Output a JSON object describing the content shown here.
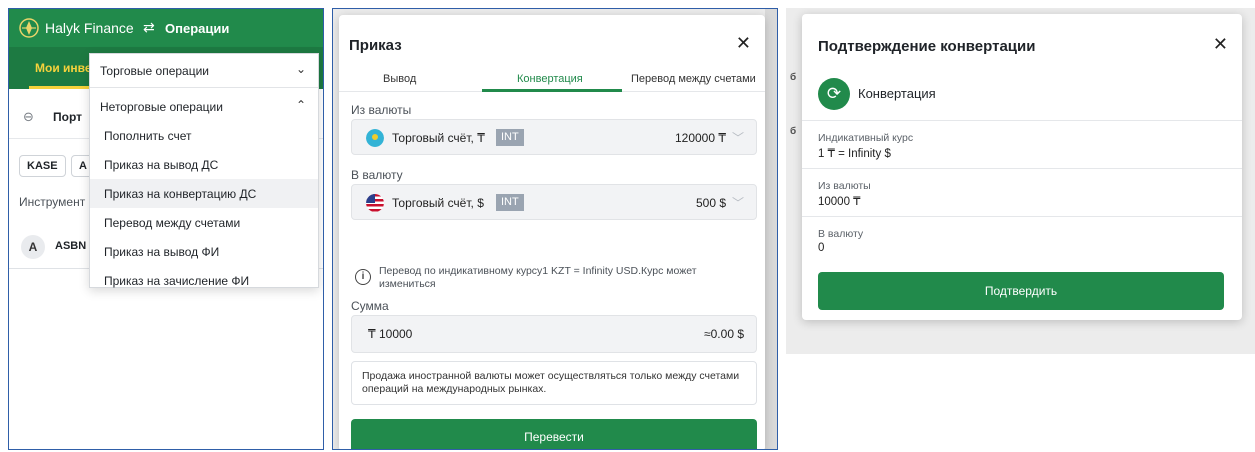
{
  "panel1": {
    "brand": "Halyk Finance",
    "nav_operations": "Операции",
    "tab_my_investments": "Мои инве",
    "portfolio_label": "Порт",
    "chip_kase": "KASE",
    "chip_a": "A",
    "instruments_label": "Инструмент",
    "row_avatar_letter": "A",
    "row_ticker": "ASBN",
    "dropdown": {
      "trade_ops": "Торговые операции",
      "nontrade_ops": "Неторговые операции",
      "items": [
        "Пополнить счет",
        "Приказ на вывод ДС",
        "Приказ на конвертацию ДС",
        "Перевод между счетами",
        "Приказ на вывод ФИ",
        "Приказ на зачисление ФИ"
      ]
    }
  },
  "panel2": {
    "title": "Приказ",
    "close": "✕",
    "tabs": [
      "Вывод",
      "Конвертация",
      "Перевод между счетами"
    ],
    "from_label": "Из валюты",
    "from_account": "Торговый счёт, ₸",
    "from_badge": "INT",
    "from_amount": "120000 ₸",
    "to_label": "В валюту",
    "to_account": "Торговый счёт, $",
    "to_badge": "INT",
    "to_amount": "500 $",
    "info_text": "Перевод по индикативному курсу1 KZT = Infinity USD.Курс может измениться",
    "sum_label": "Сумма",
    "sum_value": "₸  10000",
    "sum_converted": "≈0.00 $",
    "note": "Продажа иностранной валюты может осуществляться только между счетами операций на международных рынках.",
    "button": "Перевести"
  },
  "panel3": {
    "title": "Подтверждение конвертации",
    "close": "✕",
    "type_label": "Конвертация",
    "rate_label": "Индикативный курс",
    "rate_value": "1 ₸ = Infinity $",
    "from_label": "Из валюты",
    "from_value": "10000 ₸",
    "to_label": "В валюту",
    "to_value": "0",
    "button": "Подтвердить"
  },
  "colors": {
    "brand_green": "#218a4b",
    "accent_yellow": "#f6d23c",
    "badge_gray": "#9aa4b1"
  }
}
